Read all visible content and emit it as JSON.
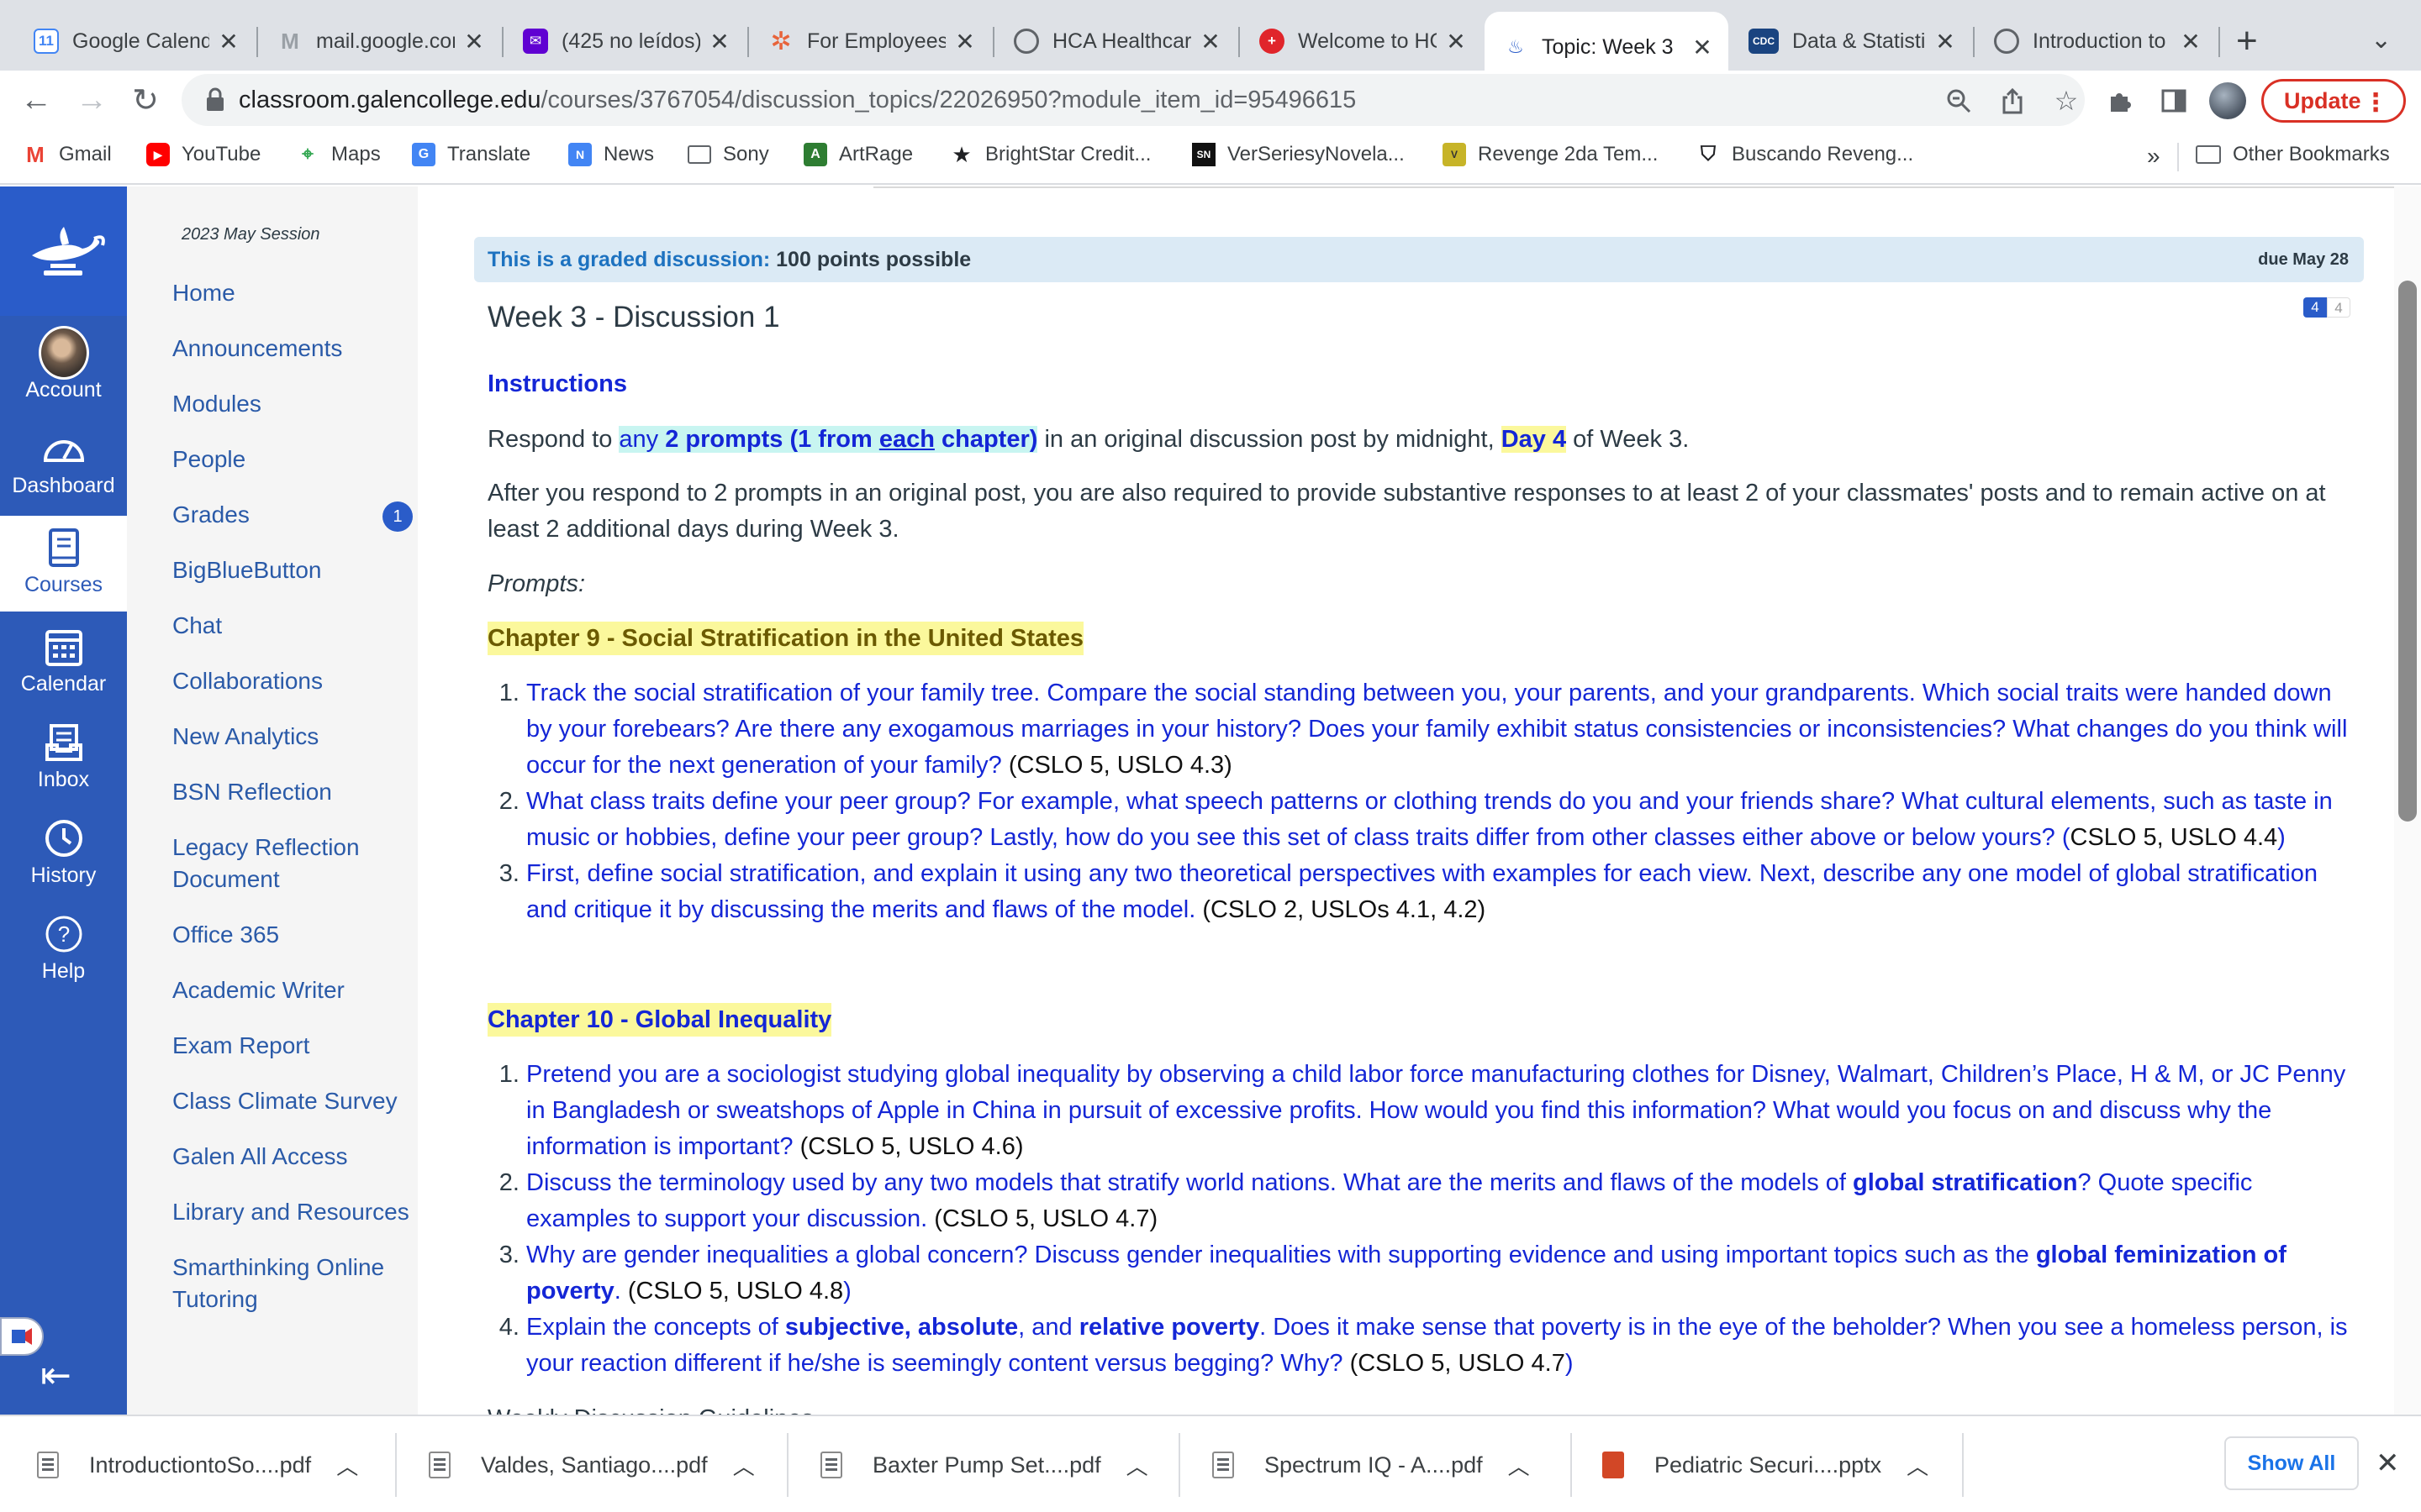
{
  "browser": {
    "tabs": [
      {
        "title": "Google Calendar",
        "icon": "calendar-icon"
      },
      {
        "title": "mail.google.com",
        "icon": "gmail-icon"
      },
      {
        "title": "(425 no leídos)",
        "icon": "yahoo-mail-icon"
      },
      {
        "title": "For Employees",
        "icon": "hca-icon"
      },
      {
        "title": "HCA Healthcare",
        "icon": "globe-icon"
      },
      {
        "title": "Welcome to HCA",
        "icon": "hca-red-icon"
      },
      {
        "title": "Topic: Week 3",
        "icon": "lamp-icon"
      },
      {
        "title": "Data & Statistics",
        "icon": "cdc-icon"
      },
      {
        "title": "Introduction to",
        "icon": "globe-icon"
      }
    ],
    "active_tab": 6,
    "url_host": "classroom.galencollege.edu",
    "url_path": "/courses/3767054/discussion_topics/22026950?module_item_id=95496615",
    "update_label": "Update",
    "bookmarks": [
      "Gmail",
      "YouTube",
      "Maps",
      "Translate",
      "News",
      "Sony",
      "ArtRage",
      "BrightStar Credit...",
      "VerSeriesyNovela...",
      "Revenge 2da Tem...",
      "Buscando Reveng..."
    ],
    "more_bookmarks": "»",
    "other_bookmarks": "Other Bookmarks"
  },
  "global_nav": {
    "items": [
      {
        "label": "Account",
        "icon": "avatar"
      },
      {
        "label": "Dashboard",
        "icon": "dashboard-icon"
      },
      {
        "label": "Courses",
        "icon": "courses-icon"
      },
      {
        "label": "Calendar",
        "icon": "calendar-icon"
      },
      {
        "label": "Inbox",
        "icon": "inbox-icon"
      },
      {
        "label": "History",
        "icon": "clock-icon"
      },
      {
        "label": "Help",
        "icon": "help-icon"
      }
    ],
    "active": "Courses"
  },
  "course_nav": {
    "session": "2023 May Session",
    "items": [
      "Home",
      "Announcements",
      "Modules",
      "People",
      "Grades",
      "BigBlueButton",
      "Chat",
      "Collaborations",
      "New Analytics",
      "BSN Reflection",
      "Legacy Reflection Document",
      "Office 365",
      "Academic Writer",
      "Exam Report",
      "Class Climate Survey",
      "Galen All Access",
      "Library and Resources",
      "Smarthinking Online Tutoring"
    ],
    "grades_badge": "1"
  },
  "discussion": {
    "graded_prefix": "This is a graded discussion:",
    "graded_points": "100 points possible",
    "due": "due May 28",
    "title": "Week 3 - Discussion 1",
    "reply_unread": "4",
    "reply_total": "4",
    "instructions_heading": "Instructions",
    "respond": {
      "p1": "Respond to ",
      "p2": "any ",
      "p3": "2 prompts (1 from ",
      "p4": "each",
      "p5": " chapter)",
      "p6": " in an original discussion post by midnight, ",
      "p7": "Day 4",
      "p8": " of Week 3."
    },
    "after": "After you respond to 2 prompts in an original post, you are also required to provide substantive responses to at least 2 of your classmates' posts and to remain active on at least 2 additional days during Week 3.",
    "prompts_label": "Prompts:",
    "chapter9": {
      "heading": "Chapter 9 - Social Stratification in the United States",
      "items": [
        {
          "text": "Track the social stratification of your family tree. Compare the social standing between you, your parents, and your grandparents. Which social traits were handed down by your forebears? Are there any exogamous marriages in your history? Does your family exhibit status consistencies or inconsistencies? What changes do you think will occur for the next generation of your family? ",
          "cslo": "(CSLO 5, USLO 4.3)"
        },
        {
          "text": "What class traits define your peer group? For example, what speech patterns or clothing trends do you and your friends share? What cultural elements, such as taste in music or hobbies, define your peer group? Lastly, how do you see this set of class traits differ from other classes either above or below yours? (",
          "cslo": "CSLO 5, USLO 4.4",
          "tail": ")"
        },
        {
          "text": "First, define social stratification, and explain it using any two theoretical perspectives with examples for each view. Next, describe any one model of global stratification and critique it by discussing the merits and flaws of the model. ",
          "cslo": "(CSLO 2, USLOs 4.1, 4.2)"
        }
      ]
    },
    "chapter10": {
      "heading": "Chapter 10 - Global Inequality",
      "items": [
        {
          "text": "Pretend you are a sociologist studying global inequality by observing a child labor force manufacturing clothes for Disney, Walmart, Children’s Place, H & M, or JC Penny in Bangladesh or sweatshops of Apple in China in pursuit of excessive profits. How would you find this information? What would you focus on and discuss why the information is important? ",
          "cslo": "(CSLO 5, USLO 4.6)"
        },
        {
          "text": "Discuss the terminology used by any two models that stratify world nations. What are the merits and flaws of the models of ",
          "bold": "global stratification",
          "text2": "? Quote specific examples to support your discussion. ",
          "cslo": "(CSLO 5, USLO 4.7)"
        },
        {
          "text": "Why are gender inequalities a global concern? Discuss gender inequalities with supporting evidence and using important topics such as the ",
          "bold": "global feminization of poverty",
          "text2": ". ",
          "cslo": "(CSLO 5, USLO 4.8",
          "tail": ")"
        },
        {
          "text": "Explain the concepts of ",
          "bold": "subjective, absolute",
          "text2": ", and ",
          "bold2": "relative poverty",
          "text3": ". Does it make sense that poverty is in the eye of the beholder? When you see a homeless person, is your reaction different if he/she is seemingly content versus begging? Why? ",
          "cslo": "(CSLO 5, USLO 4.7",
          "tail": ")"
        }
      ]
    },
    "next_section_cut": "Weekly Discussion Guidelines"
  },
  "downloads": {
    "items": [
      {
        "name": "IntroductiontoSo....pdf",
        "type": "pdf"
      },
      {
        "name": "Valdes, Santiago....pdf",
        "type": "pdf"
      },
      {
        "name": "Baxter Pump Set....pdf",
        "type": "pdf"
      },
      {
        "name": "Spectrum IQ - A....pdf",
        "type": "pdf"
      },
      {
        "name": "Pediatric Securi....pptx",
        "type": "pptx"
      }
    ],
    "show_all": "Show All"
  },
  "colors": {
    "canvas_blue": "#2d5ab8",
    "link_blue": "#2a5aa8",
    "prompt_blue": "#1426d6",
    "highlight_yellow": "#fbf89c",
    "highlight_cyan": "#c8f5f1",
    "update_red": "#d93025"
  }
}
